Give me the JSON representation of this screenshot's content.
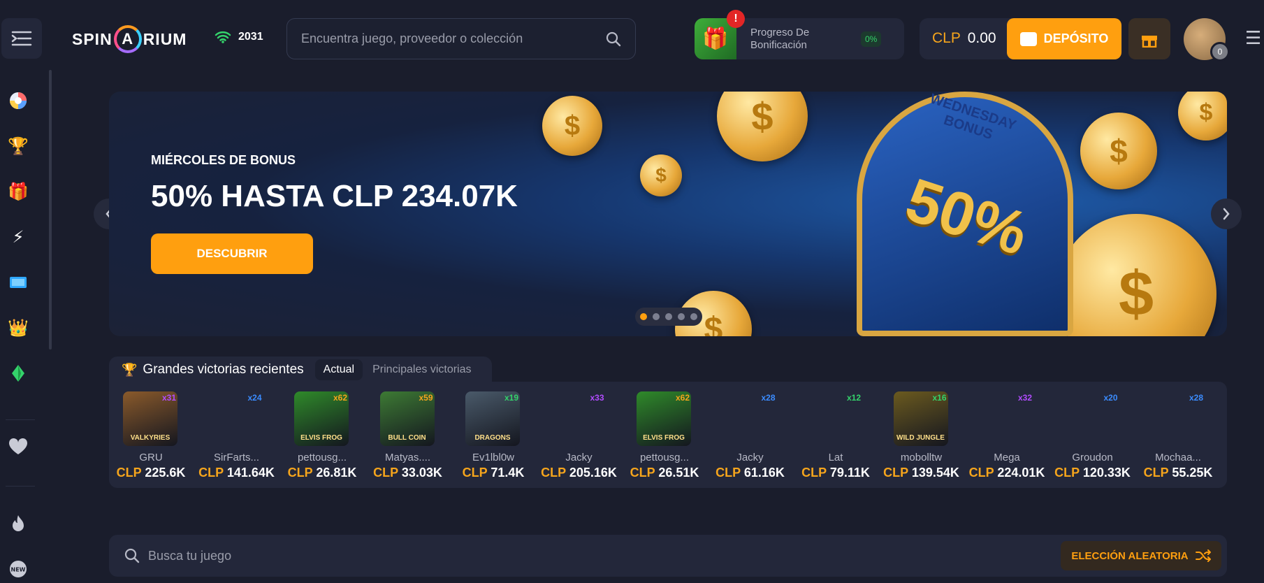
{
  "header": {
    "logo_text_left": "SPIN",
    "logo_letter": "A",
    "logo_text_right": "RIUM",
    "online_count": "2031",
    "search_placeholder": "Encuentra juego, proveedor o colección",
    "bonus_progress_label": "Progreso De Bonificación",
    "bonus_progress_pct": "0%",
    "bonus_alert": "!",
    "balance_currency": "CLP",
    "balance_value": "0.00",
    "deposit_label": "DEPÓSITO",
    "avatar_level": "0",
    "icons": [
      "menu-collapse-icon",
      "wifi-icon",
      "search-icon",
      "gift-icon",
      "wallet-icon",
      "hamburger-icon"
    ]
  },
  "sidebar": {
    "items": [
      "casino-chip-icon",
      "trophy-icon",
      "gift-icon",
      "lightning-icon",
      "ticket-icon",
      "crown-icon",
      "diamond-icon",
      "heart-icon",
      "fire-icon",
      "new-badge-icon"
    ]
  },
  "hero": {
    "kicker": "MIÉRCOLES DE BONUS",
    "headline": "50% HASTA CLP 234.07K",
    "cta": "DESCUBRIR",
    "art_top": "WEDNESDAY BONUS",
    "art_big": "50%",
    "slides": 5,
    "active_slide": 0
  },
  "wins": {
    "title": "Grandes victorias recientes",
    "tabs": [
      "Actual",
      "Principales victorias"
    ],
    "items": [
      {
        "user": "GRU",
        "cur": "CLP",
        "amt": "225.6K",
        "mult": "x31",
        "multColor": "#b24cff",
        "thumb": "#8a5a2b",
        "art": "VALKYRIES"
      },
      {
        "user": "SirFarts...",
        "cur": "CLP",
        "amt": "141.64K",
        "mult": "x24",
        "multColor": "#3b8cff",
        "thumb": "",
        "art": ""
      },
      {
        "user": "pettousg...",
        "cur": "CLP",
        "amt": "26.81K",
        "mult": "x62",
        "multColor": "#f6a51c",
        "thumb": "#2f8a2a",
        "art": "ELVIS FROG"
      },
      {
        "user": "Matyas....",
        "cur": "CLP",
        "amt": "33.03K",
        "mult": "x59",
        "multColor": "#f6a51c",
        "thumb": "#3d7a34",
        "art": "BULL COIN"
      },
      {
        "user": "Ev1lbl0w",
        "cur": "CLP",
        "amt": "71.4K",
        "mult": "x19",
        "multColor": "#34d36b",
        "thumb": "#4a5a6a",
        "art": "DRAGONS"
      },
      {
        "user": "Jacky",
        "cur": "CLP",
        "amt": "205.16K",
        "mult": "x33",
        "multColor": "#b24cff",
        "thumb": "",
        "art": ""
      },
      {
        "user": "pettousg...",
        "cur": "CLP",
        "amt": "26.51K",
        "mult": "x62",
        "multColor": "#f6a51c",
        "thumb": "#2f8a2a",
        "art": "ELVIS FROG"
      },
      {
        "user": "Jacky",
        "cur": "CLP",
        "amt": "61.16K",
        "mult": "x28",
        "multColor": "#3b8cff",
        "thumb": "",
        "art": ""
      },
      {
        "user": "Lat",
        "cur": "CLP",
        "amt": "79.11K",
        "mult": "x12",
        "multColor": "#34d36b",
        "thumb": "",
        "art": ""
      },
      {
        "user": "mobolltw",
        "cur": "CLP",
        "amt": "139.54K",
        "mult": "x16",
        "multColor": "#34d36b",
        "thumb": "#6b5a1f",
        "art": "WILD JUNGLE"
      },
      {
        "user": "Mega",
        "cur": "CLP",
        "amt": "224.01K",
        "mult": "x32",
        "multColor": "#b24cff",
        "thumb": "",
        "art": ""
      },
      {
        "user": "Groudon",
        "cur": "CLP",
        "amt": "120.33K",
        "mult": "x20",
        "multColor": "#3b8cff",
        "thumb": "",
        "art": ""
      },
      {
        "user": "Mochaa...",
        "cur": "CLP",
        "amt": "55.25K",
        "mult": "x28",
        "multColor": "#3b8cff",
        "thumb": "",
        "art": ""
      }
    ]
  },
  "game_search": {
    "placeholder": "Busca tu juego",
    "random_label": "ELECCIÓN ALEATORIA"
  },
  "colors": {
    "accent": "#ff9f0f",
    "bg": "#1a1d2c",
    "panel": "#23273a"
  }
}
